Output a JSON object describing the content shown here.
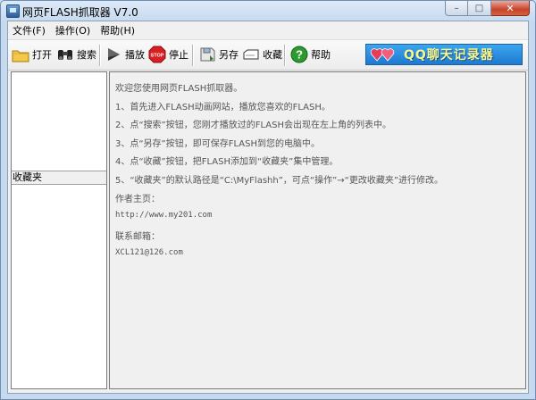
{
  "window": {
    "title": "网页FLASH抓取器 V7.0"
  },
  "caption": {
    "minimize": "–",
    "maximize": "□",
    "close": "✕"
  },
  "menu": [
    {
      "label": "文件(F)"
    },
    {
      "label": "操作(O)"
    },
    {
      "label": "帮助(H)"
    }
  ],
  "toolbar": {
    "open_label": "打开",
    "search_label": "搜索",
    "play_label": "播放",
    "stop_label": "停止",
    "stop_sign": "STOP",
    "saveas_label": "另存",
    "favorite_label": "收藏",
    "help_label": "帮助",
    "banner_text": "QQ聊天记录器",
    "accent_color": "#1f79cf"
  },
  "left_panel": {
    "header": "收藏夹"
  },
  "info": {
    "lines": [
      "欢迎您使用网页FLASH抓取器。",
      "1、首先进入FLASH动画网站，播放您喜欢的FLASH。",
      "2、点“搜索”按钮，您刚才播放过的FLASH会出现在左上角的列表中。",
      "3、点“另存”按钮，即可保存FLASH到您的电脑中。",
      "4、点“收藏”按钮，把FLASH添加到“收藏夹”集中管理。",
      "5、“收藏夹”的默认路径是“C:\\MyFlashh”，可点“操作”→“更改收藏夹”进行修改。",
      "作者主页：",
      "http://www.my201.com",
      "联系邮箱：",
      "XCL121@126.com"
    ]
  }
}
